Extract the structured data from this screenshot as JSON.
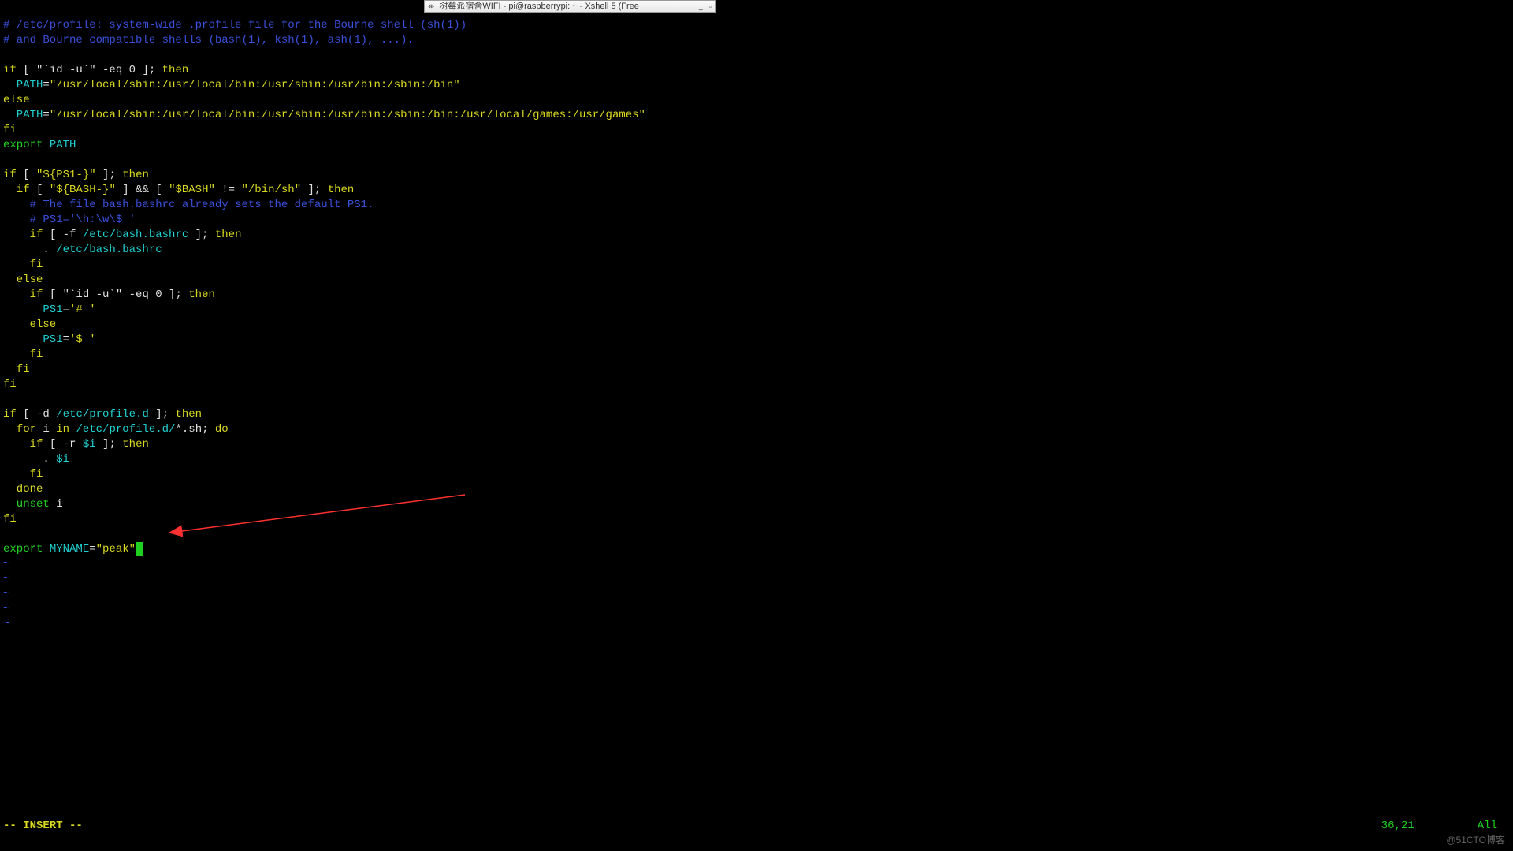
{
  "window": {
    "title": "树莓派宿舍WIFI - pi@raspberrypi: ~ - Xshell 5 (Free",
    "pin_icon": "⇹",
    "minimize": "_",
    "maximize": "▫"
  },
  "code": {
    "l1": "# /etc/profile: system-wide .profile file for the Bourne shell (sh(1))",
    "l2": "# and Bourne compatible shells (bash(1), ksh(1), ash(1), ...).",
    "l3_if": "if",
    "l3_rest": " [ \"`id -u`\" -eq 0 ]; ",
    "l3_then": "then",
    "l4_path": "  PATH",
    "l4_eq": "=",
    "l4_val": "\"/usr/local/sbin:/usr/local/bin:/usr/sbin:/usr/bin:/sbin:/bin\"",
    "l5": "else",
    "l6_path": "  PATH",
    "l6_eq": "=",
    "l6_val": "\"/usr/local/sbin:/usr/local/bin:/usr/sbin:/usr/bin:/sbin:/bin:/usr/local/games:/usr/games\"",
    "l7": "fi",
    "l8_export": "export",
    "l8_var": " PATH",
    "l10_if": "if",
    "l10_mid": " [ ",
    "l10_str": "\"${PS1-}\"",
    "l10_rest": " ]; ",
    "l10_then": "then",
    "l11_if": "  if",
    "l11_mid": " [ ",
    "l11_str1": "\"${BASH-}\"",
    "l11_mid2": " ] && [ ",
    "l11_str2": "\"$BASH\"",
    "l11_mid3": " != ",
    "l11_str3": "\"/bin/sh\"",
    "l11_rest": " ]; ",
    "l11_then": "then",
    "l12": "    # The file bash.bashrc already sets the default PS1.",
    "l13": "    # PS1='\\h:\\w\\$ '",
    "l14_if": "    if",
    "l14_mid": " [ -f ",
    "l14_path": "/etc/bash.bashrc",
    "l14_rest": " ]; ",
    "l14_then": "then",
    "l15_dot": "      . ",
    "l15_path": "/etc/bash.bashrc",
    "l16": "    fi",
    "l17": "  else",
    "l18_if": "    if",
    "l18_rest": " [ \"`id -u`\" -eq 0 ]; ",
    "l18_then": "then",
    "l19_var": "      PS1",
    "l19_eq": "=",
    "l19_val": "'# '",
    "l20": "    else",
    "l21_var": "      PS1",
    "l21_eq": "=",
    "l21_val": "'$ '",
    "l22": "    fi",
    "l23": "  fi",
    "l24": "fi",
    "l26_if": "if",
    "l26_mid": " [ -d ",
    "l26_path": "/etc/profile.d",
    "l26_rest": " ]; ",
    "l26_then": "then",
    "l27_for": "  for",
    "l27_i": " i ",
    "l27_in": "in ",
    "l27_path": "/etc/profile.d/",
    "l27_glob": "*.sh; ",
    "l27_do": "do",
    "l28_if": "    if",
    "l28_mid": " [ -r ",
    "l28_var": "$i",
    "l28_rest": " ]; ",
    "l28_then": "then",
    "l29_dot": "      . ",
    "l29_var": "$i",
    "l30": "    fi",
    "l31": "  done",
    "l32_unset": "  unset",
    "l32_i": " i",
    "l33": "fi",
    "l35_export": "export",
    "l35_var": " MYNAME",
    "l35_eq": "=",
    "l35_val": "\"peak\"",
    "tilde": "~"
  },
  "status": {
    "mode": "-- INSERT --",
    "position": "36,21",
    "scroll": "All"
  },
  "watermark": "@51CTO博客"
}
